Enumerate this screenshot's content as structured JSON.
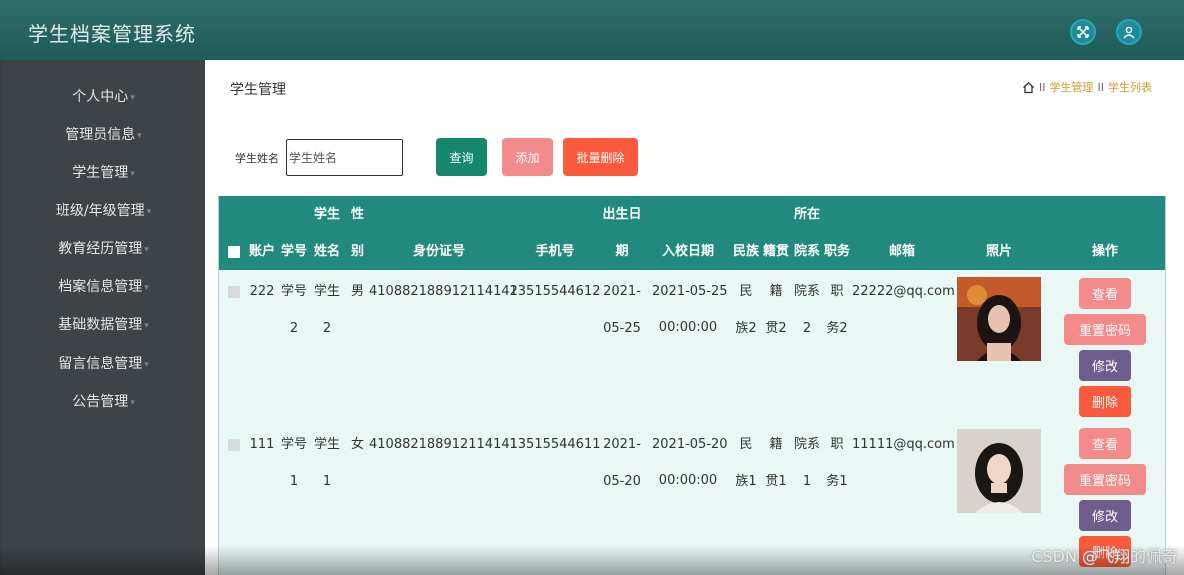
{
  "app": {
    "title": "学生档案管理系统"
  },
  "header": {
    "icons": [
      "fullscreen-icon",
      "user-icon"
    ],
    "accent": "#1f5b58"
  },
  "sidebar": {
    "items": [
      {
        "label": "个人中心"
      },
      {
        "label": "管理员信息"
      },
      {
        "label": "学生管理"
      },
      {
        "label": "班级/年级管理"
      },
      {
        "label": "教育经历管理"
      },
      {
        "label": "档案信息管理"
      },
      {
        "label": "基础数据管理"
      },
      {
        "label": "留言信息管理"
      },
      {
        "label": "公告管理"
      }
    ]
  },
  "main": {
    "title": "学生管理",
    "breadcrumb": {
      "sep": "II",
      "items": [
        "学生管理",
        "学生列表"
      ]
    },
    "search": {
      "label": "学生姓名",
      "placeholder": "学生姓名",
      "value": ""
    },
    "buttons": {
      "query": "查询",
      "add": "添加",
      "batch_delete": "批量删除"
    }
  },
  "table": {
    "headers": {
      "account": "账户",
      "student_no": "学号",
      "name": "学生姓名",
      "gender": "性别",
      "id_card": "身份证号",
      "phone": "手机号",
      "birthday": "出生日期",
      "enroll_date": "入校日期",
      "ethnicity": "民族",
      "native_place": "籍贯",
      "department": "所在院系",
      "position": "职务",
      "email": "邮箱",
      "photo": "照片",
      "actions": "操作"
    },
    "rows": [
      {
        "account": "222",
        "student_no": "学号2",
        "name": "学生2",
        "gender": "男",
        "id_card": "410882188912114142",
        "phone": "13515544612",
        "birthday": "2021-05-25",
        "enroll_date": "2021-05-25",
        "enroll_time": "00:00:00",
        "ethnicity": "民族2",
        "native_place": "籍贯2",
        "department": "院系2",
        "position": "职务2",
        "email": "22222@qq.com"
      },
      {
        "account": "111",
        "student_no": "学号1",
        "name": "学生1",
        "gender": "女",
        "id_card": "410882188912114141",
        "phone": "13515544611",
        "birthday": "2021-05-20",
        "enroll_date": "2021-05-20",
        "enroll_time": "00:00:00",
        "ethnicity": "民族1",
        "native_place": "籍贯1",
        "department": "院系1",
        "position": "职务1",
        "email": "11111@qq.com"
      }
    ],
    "actions": {
      "view": "查看",
      "reset_password": "重置密码",
      "edit": "修改",
      "delete": "删除"
    }
  },
  "watermark": "CSDN @飞翔的佩奇"
}
